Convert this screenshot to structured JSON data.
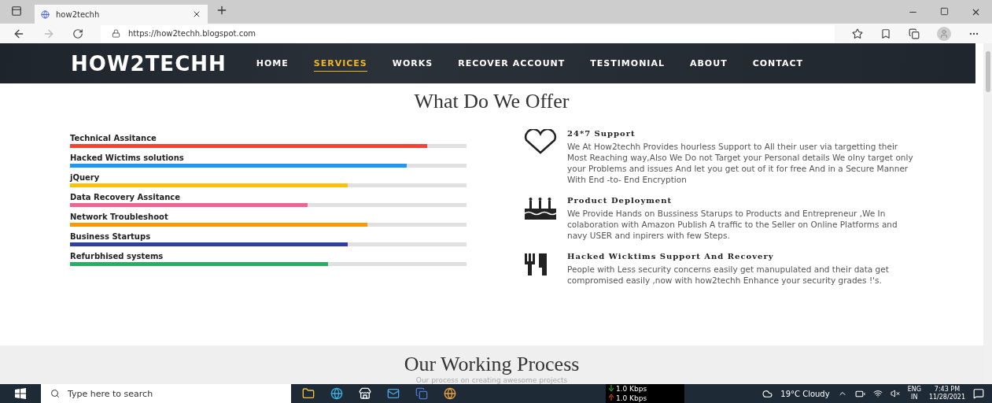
{
  "browser": {
    "tab_title": "how2techh",
    "url": "https://how2techh.blogspot.com"
  },
  "site": {
    "logo": "HOW2TECHH",
    "nav": [
      {
        "label": "HOME",
        "selected": false
      },
      {
        "label": "SERVICES",
        "selected": true
      },
      {
        "label": "WORKS",
        "selected": false
      },
      {
        "label": "RECOVER ACCOUNT",
        "selected": false
      },
      {
        "label": "TESTIMONIAL",
        "selected": false
      },
      {
        "label": "ABOUT",
        "selected": false
      },
      {
        "label": "CONTACT",
        "selected": false
      }
    ]
  },
  "offer": {
    "title": "What Do We Offer",
    "skills": [
      {
        "name": "Technical Assitance",
        "level": 0.9,
        "color": "#f44336"
      },
      {
        "name": "Hacked Wictims solutions",
        "level": 0.85,
        "color": "#2196f3"
      },
      {
        "name": "jQuery",
        "level": 0.7,
        "color": "#ffc107"
      },
      {
        "name": "Data Recovery Assitance",
        "level": 0.6,
        "color": "#f06292"
      },
      {
        "name": "Network Troubleshoot",
        "level": 0.75,
        "color": "#ff9800"
      },
      {
        "name": "Business Startups",
        "level": 0.7,
        "color": "#303f9f"
      },
      {
        "name": "Refurbhised systems",
        "level": 0.65,
        "color": "#27ae60"
      }
    ],
    "services": [
      {
        "kind": "heart",
        "title": "24*7 Support",
        "text": "We At How2techh Provides hourless Support to All their user via targetting their Most Reaching way,Also We Do not Target your Personal details We olny target only your Problems and issues And let you get out of it for free And in a Secure Manner With End -to- End Encryption"
      },
      {
        "kind": "cake",
        "title": "Product Deployment",
        "text": "We Provide Hands on Bussiness Starups to Products and Entrepreneur ,We In colaboration with Amazon Publish A traffic to the Seller on Online Platforms and navy USER and inpirers with few Steps."
      },
      {
        "kind": "cutlery",
        "title": "Hacked Wicktims Support And Recovery",
        "text": "People with Less security concerns easily get manupulated and their data get compromised easily ,now with how2techh Enhance your security grades !'s."
      }
    ]
  },
  "process": {
    "title": "Our Working Process",
    "subtitle": "Our process on creating awesome projects"
  },
  "taskbar": {
    "search_placeholder": "Type here to search",
    "net_down": "1.0 Kbps",
    "net_up": "1.0 Kbps",
    "weather": "19°C  Cloudy",
    "lang": "ENG",
    "region": "IN",
    "time": "7:43 PM",
    "date": "11/28/2021"
  }
}
